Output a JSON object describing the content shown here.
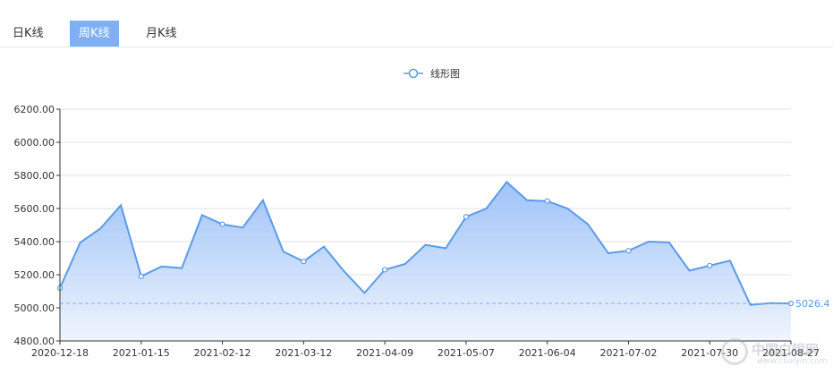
{
  "tabs": [
    {
      "label": "日K线",
      "active": false
    },
    {
      "label": "周K线",
      "active": true
    },
    {
      "label": "月K线",
      "active": false
    }
  ],
  "colors": {
    "accent": "#7fb0f6",
    "line": "#5b9be8",
    "grid": "#e5e5e5"
  },
  "watermark": {
    "title": "中国白银网",
    "url": "www.cbaiyin.com"
  },
  "chart_data": {
    "type": "area",
    "legend": "线形图",
    "legend_position": "top-center",
    "x_tick_labels": [
      "2020-12-18",
      "2021-01-15",
      "2021-02-12",
      "2021-03-12",
      "2021-04-09",
      "2021-05-07",
      "2021-06-04",
      "2021-07-02",
      "2021-07-30",
      "2021-08-27"
    ],
    "y_tick_labels": [
      "4800.00",
      "5000.00",
      "5200.00",
      "5400.00",
      "5600.00",
      "5800.00",
      "6000.00",
      "6200.00"
    ],
    "ylim": [
      4800,
      6200
    ],
    "grid": true,
    "markline_label": "5026.4",
    "markline_value": 5026.4,
    "series": [
      {
        "values": [
          5120,
          5395,
          5480,
          5620,
          5190,
          5250,
          5240,
          5560,
          5505,
          5485,
          5650,
          5340,
          5280,
          5370,
          5220,
          5090,
          5230,
          5265,
          5380,
          5360,
          5550,
          5600,
          5760,
          5650,
          5645,
          5600,
          5505,
          5330,
          5345,
          5400,
          5395,
          5225,
          5255,
          5285,
          5018,
          5028,
          5026.4
        ]
      }
    ],
    "marked_points": [
      0,
      4,
      8,
      12,
      16,
      20,
      24,
      28,
      32,
      36
    ]
  }
}
